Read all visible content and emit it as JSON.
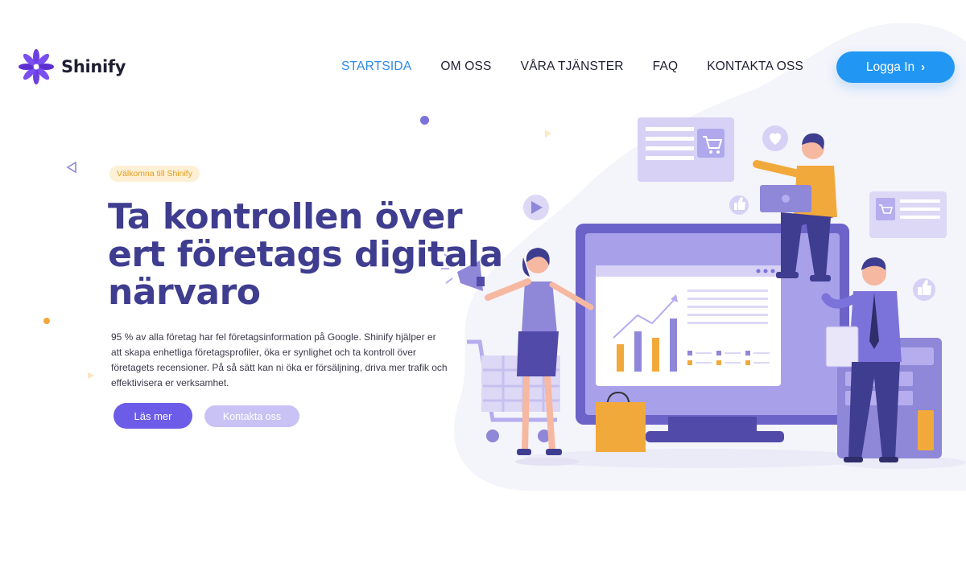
{
  "brand": {
    "name": "Shinify"
  },
  "nav": {
    "items": [
      {
        "label": "STARTSIDA",
        "active": true
      },
      {
        "label": "OM OSS",
        "active": false
      },
      {
        "label": "VÅRA TJÄNSTER",
        "active": false
      },
      {
        "label": "FAQ",
        "active": false
      },
      {
        "label": "KONTAKTA OSS",
        "active": false
      }
    ],
    "login_label": "Logga In",
    "login_icon": "chevron-right-icon"
  },
  "hero": {
    "badge": "Välkomna till Shinify",
    "title": "Ta kontrollen över ert företags digitala närvaro",
    "text": "95 % av alla företag har fel företagsinformation på Google. Shinify hjälper er att skapa enhetliga företagsprofiler, öka er synlighet och ta kontroll över företagets recensioner. På så sätt kan ni öka er försäljning, driva mer trafik och effektivisera er verksamhet.",
    "primary_button": "Läs mer",
    "secondary_button": "Kontakta oss"
  },
  "colors": {
    "accent": "#2196f3",
    "nav_active": "#2e8be8",
    "title": "#3f3d8f",
    "primary_button": "#6c5ce7",
    "secondary_button": "#c9c2f4",
    "logo": "#6c3fe0"
  }
}
